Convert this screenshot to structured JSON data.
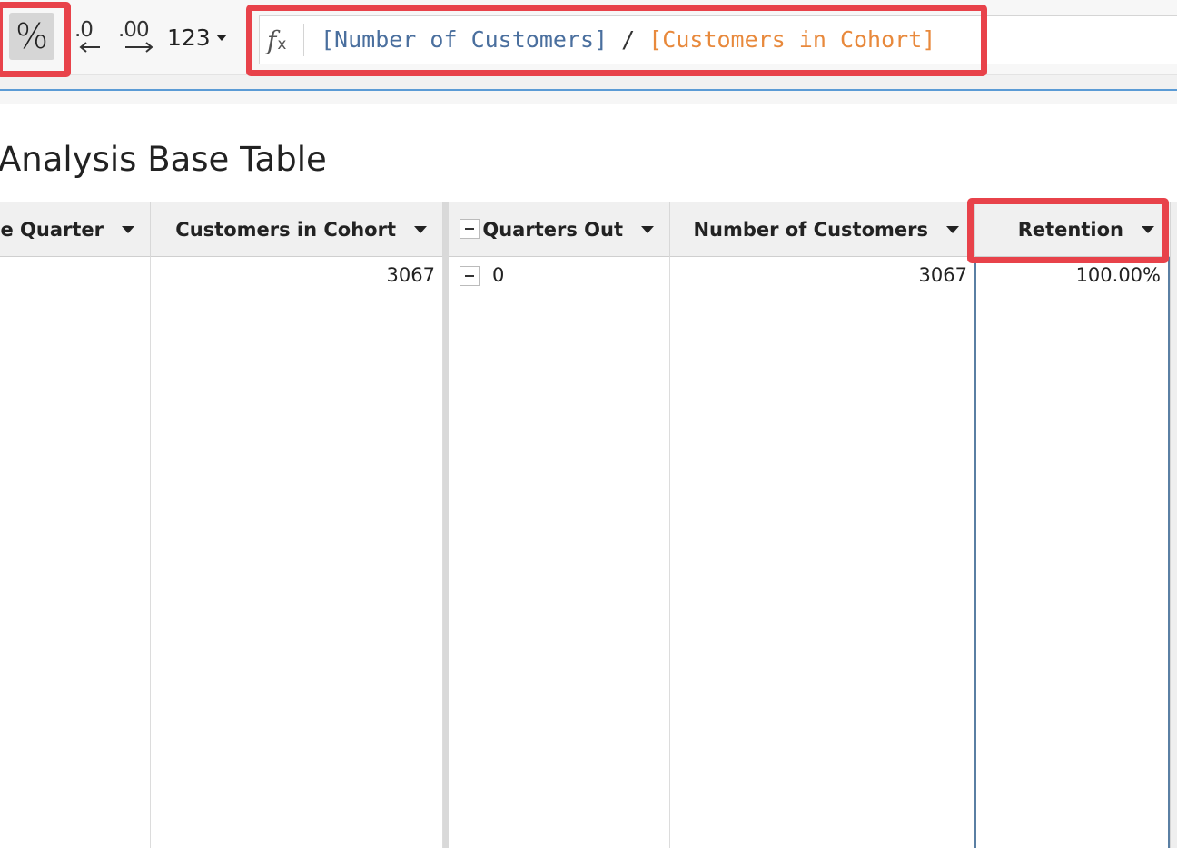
{
  "toolbar": {
    "percent_label": "%",
    "decrease_decimals_label": ".0",
    "increase_decimals_label": ".00",
    "number_format_label": "123"
  },
  "formula": {
    "fx_label": "f",
    "fx_sub": "x",
    "operand_a": "[Number of Customers]",
    "operator": " / ",
    "operand_b": "[Customers in Cohort]"
  },
  "table": {
    "title": "Analysis Base Table",
    "columns": [
      {
        "label": "ase Quarter"
      },
      {
        "label": "Customers in Cohort"
      },
      {
        "label": "Quarters Out"
      },
      {
        "label": "Number of Customers"
      },
      {
        "label": "Retention"
      }
    ],
    "rows": [
      {
        "customers_in_cohort": "3067",
        "quarters_out": "0",
        "number_of_customers": "3067",
        "retention": "100.00%"
      }
    ]
  },
  "colors": {
    "highlight": "#e8424a",
    "formula_field_a": "#4a6f9e",
    "formula_field_b": "#e8893c",
    "selected_column_border": "#5a7fa3"
  }
}
